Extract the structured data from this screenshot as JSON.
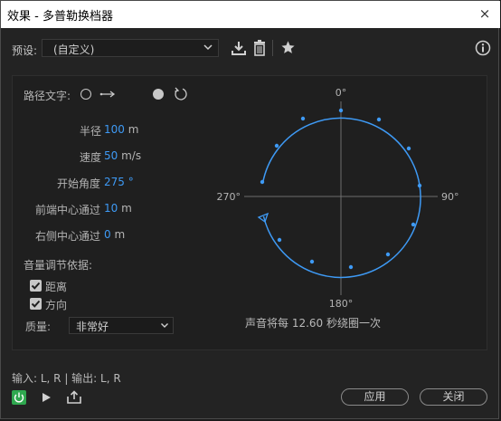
{
  "window": {
    "title": "效果 - 多普勒换档器",
    "close_symbol": "×"
  },
  "preset": {
    "label": "预设:",
    "value": "(自定义)"
  },
  "path_text": {
    "label": "路径文字:"
  },
  "params": {
    "radius": {
      "label": "半径",
      "value": "100",
      "unit": "m"
    },
    "speed": {
      "label": "速度",
      "value": "50",
      "unit": "m/s"
    },
    "start_angle": {
      "label": "开始角度",
      "value": "275 °"
    },
    "front_center": {
      "label": "前端中心通过",
      "value": "10",
      "unit": "m"
    },
    "right_center": {
      "label": "右侧中心通过",
      "value": "0",
      "unit": "m"
    }
  },
  "volume": {
    "label": "音量调节依据:",
    "distance": {
      "label": "距离",
      "checked": true
    },
    "direction": {
      "label": "方向",
      "checked": true
    }
  },
  "quality": {
    "label": "质量:",
    "value": "非常好"
  },
  "diagram": {
    "label_top": "0°",
    "label_right": "90°",
    "label_bottom": "180°",
    "label_left": "270°",
    "caption": "声音将每 12.60 秒绕圈一次",
    "accent": "#3e9af5"
  },
  "footer": {
    "io_text": "输入: L, R | 输出: L, R",
    "apply_label": "应用",
    "close_label": "关闭",
    "power_color": "#2fa84f"
  }
}
